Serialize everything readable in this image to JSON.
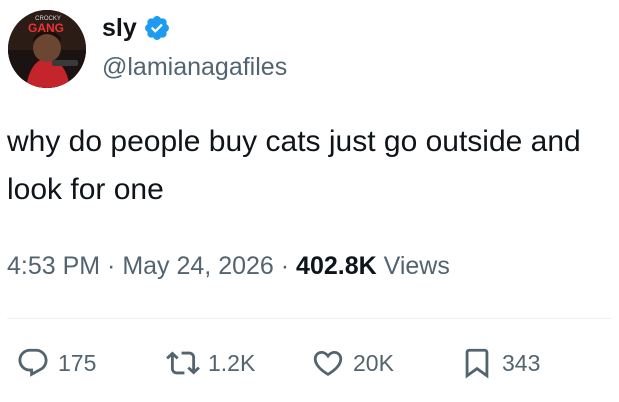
{
  "user": {
    "display_name": "sly",
    "handle": "@lamianagafiles",
    "verified_icon": "verified-badge-icon",
    "avatar_text": "GANG",
    "avatar_small_text": "CROCKY"
  },
  "tweet": {
    "text": "why do people buy cats just go outside and look for one"
  },
  "meta": {
    "time": "4:53 PM",
    "sep1": " · ",
    "date": "May 24, 2026",
    "sep2": " · ",
    "views_count": "402.8K",
    "views_label": " Views"
  },
  "actions": {
    "replies": "175",
    "reposts": "1.2K",
    "likes": "20K",
    "bookmarks": "343"
  },
  "colors": {
    "verified": "#1d9bf0",
    "secondary_text": "#536471",
    "primary_text": "#0f1419"
  }
}
